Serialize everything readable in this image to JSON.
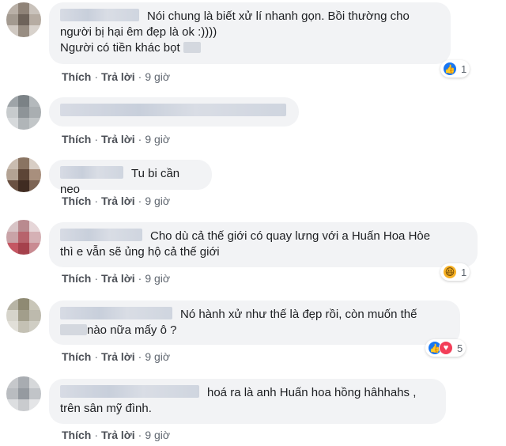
{
  "actions": {
    "like": "Thích",
    "reply": "Trả lời",
    "separator": "·"
  },
  "comments": [
    {
      "lines": [
        "Nói chung là biết xử lí nhanh gọn. Bồi thường cho",
        "người bị hại êm đẹp là ok :))))",
        "Người có tiền khác bọt"
      ],
      "time": "9 giờ",
      "reactions": {
        "icons": [
          "like"
        ],
        "count": "1"
      }
    },
    {
      "lines": [
        ""
      ],
      "time": "9 giờ"
    },
    {
      "lines": [
        "Tu bi cần neo"
      ],
      "time": "9 giờ"
    },
    {
      "lines": [
        "Cho dù cả thế giới có quay lưng với a Huấn Hoa Hòe",
        "thì e vẫn sẽ ủng hộ cả thế giới"
      ],
      "time": "9 giờ",
      "reactions": {
        "icons": [
          "haha"
        ],
        "count": "1"
      }
    },
    {
      "lines": [
        "Nó hành xử như thế là đẹp rồi, còn muốn thế",
        "nào nữa mấy ô ?"
      ],
      "time": "9 giờ",
      "reactions": {
        "icons": [
          "like",
          "love"
        ],
        "count": "5"
      }
    },
    {
      "lines": [
        "hoá ra là anh Huấn hoa hồng hâhhahs ,",
        "trên sân mỹ đình."
      ],
      "time": "9 giờ"
    }
  ],
  "icons": {
    "like": "thumbs-up-icon",
    "love": "heart-icon",
    "haha": "laughing-face-icon"
  },
  "colors": {
    "bubble": "#f2f3f5",
    "action_text": "#606770",
    "like_blue": "#1877f2",
    "love_red": "#f33e58",
    "haha_yellow": "#f7b125"
  }
}
